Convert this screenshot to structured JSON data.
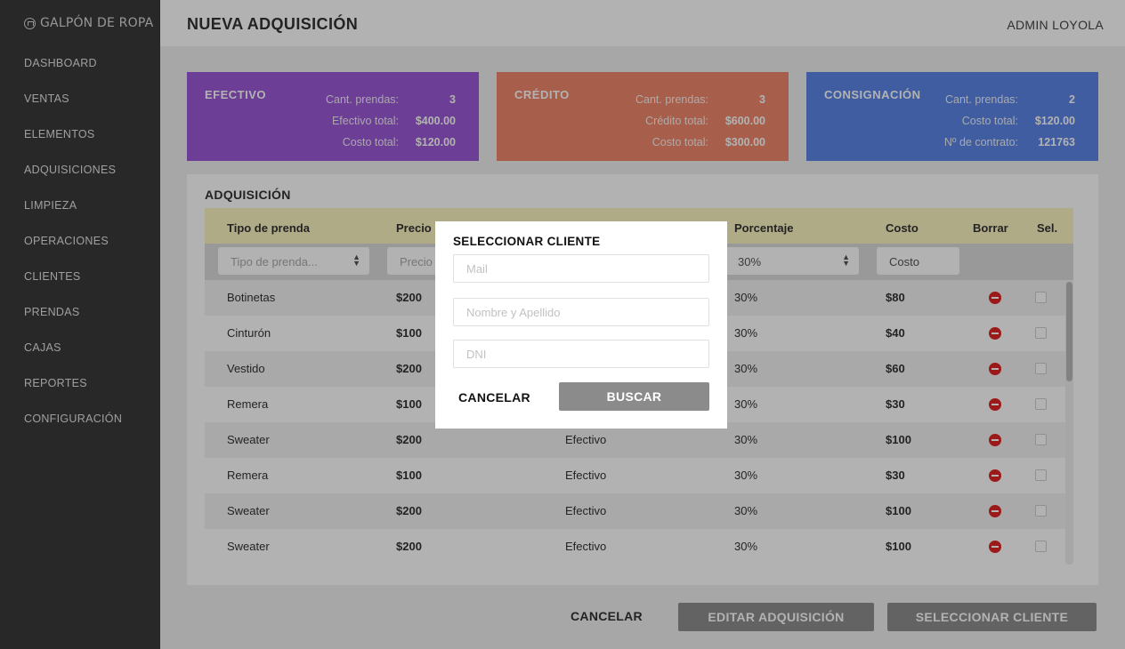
{
  "app": {
    "logo": "GALPÓN DE ROPA"
  },
  "sidebar": {
    "items": [
      {
        "label": "DASHBOARD"
      },
      {
        "label": "VENTAS"
      },
      {
        "label": "ELEMENTOS"
      },
      {
        "label": "ADQUISICIONES"
      },
      {
        "label": "LIMPIEZA"
      },
      {
        "label": "OPERACIONES"
      },
      {
        "label": "CLIENTES"
      },
      {
        "label": "PRENDAS"
      },
      {
        "label": "CAJAS"
      },
      {
        "label": "REPORTES"
      },
      {
        "label": "CONFIGURACIÓN"
      }
    ]
  },
  "header": {
    "title": "NUEVA ADQUISICIÓN",
    "user": "ADMIN LOYOLA"
  },
  "cards": {
    "efectivo": {
      "title": "EFECTIVO",
      "color": "#9b59d6",
      "rows": [
        {
          "label": "Cant. prendas:",
          "value": "3"
        },
        {
          "label": "Efectivo total:",
          "value": "$400.00"
        },
        {
          "label": "Costo total:",
          "value": "$120.00"
        }
      ]
    },
    "credito": {
      "title": "CRÉDITO",
      "color": "#f0876a",
      "rows": [
        {
          "label": "Cant. prendas:",
          "value": "3"
        },
        {
          "label": "Crédito total:",
          "value": "$600.00"
        },
        {
          "label": "Costo total:",
          "value": "$300.00"
        }
      ]
    },
    "consignacion": {
      "title": "CONSIGNACIÓN",
      "color": "#5b86e6",
      "rows": [
        {
          "label": "Cant. prendas:",
          "value": "2"
        },
        {
          "label": "Costo total:",
          "value": "$120.00"
        },
        {
          "label": "Nº de contrato:",
          "value": "121763"
        }
      ]
    }
  },
  "table": {
    "title": "ADQUISICIÓN",
    "headers": {
      "tipo": "Tipo de prenda",
      "precio": "Precio",
      "porcentaje": "Porcentaje",
      "costo": "Costo",
      "borrar": "Borrar",
      "sel": "Sel."
    },
    "filters": {
      "tipo": "Tipo de prenda...",
      "precio": "Precio",
      "porcentaje": "30%",
      "costo": "Costo"
    },
    "rows": [
      {
        "tipo": "Botinetas",
        "precio": "$200",
        "pago": "",
        "porcentaje": "30%",
        "costo": "$80"
      },
      {
        "tipo": "Cinturón",
        "precio": "$100",
        "pago": "",
        "porcentaje": "30%",
        "costo": "$40"
      },
      {
        "tipo": "Vestido",
        "precio": "$200",
        "pago": "",
        "porcentaje": "30%",
        "costo": "$60"
      },
      {
        "tipo": "Remera",
        "precio": "$100",
        "pago": "",
        "porcentaje": "30%",
        "costo": "$30"
      },
      {
        "tipo": "Sweater",
        "precio": "$200",
        "pago": "Efectivo",
        "porcentaje": "30%",
        "costo": "$100"
      },
      {
        "tipo": "Remera",
        "precio": "$100",
        "pago": "Efectivo",
        "porcentaje": "30%",
        "costo": "$30"
      },
      {
        "tipo": "Sweater",
        "precio": "$200",
        "pago": "Efectivo",
        "porcentaje": "30%",
        "costo": "$100"
      },
      {
        "tipo": "Sweater",
        "precio": "$200",
        "pago": "Efectivo",
        "porcentaje": "30%",
        "costo": "$100"
      }
    ]
  },
  "footer": {
    "cancel": "CANCELAR",
    "edit": "EDITAR ADQUISICIÓN",
    "select_client": "SELECCIONAR CLIENTE"
  },
  "modal": {
    "title": "SELECCIONAR CLIENTE",
    "mail_placeholder": "Mail",
    "name_placeholder": "Nombre y Apellido",
    "dni_placeholder": "DNI",
    "cancel": "CANCELAR",
    "search": "BUSCAR"
  }
}
